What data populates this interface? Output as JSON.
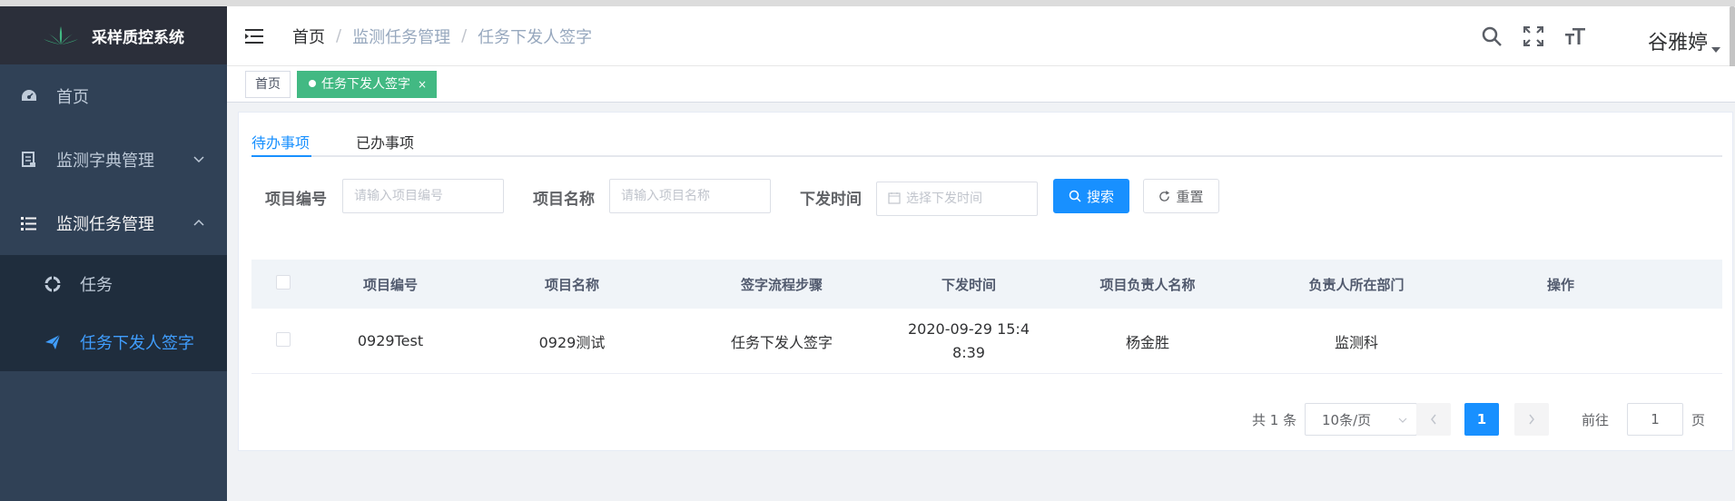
{
  "app": {
    "title": "采样质控系统"
  },
  "sidebar": {
    "items": [
      {
        "label": "首页"
      },
      {
        "label": "监测字典管理"
      },
      {
        "label": "监测任务管理"
      }
    ],
    "subitems": [
      {
        "label": "任务"
      },
      {
        "label": "任务下发人签字"
      }
    ]
  },
  "header": {
    "breadcrumb": [
      "首页",
      "监测任务管理",
      "任务下发人签字"
    ],
    "breadcrumb_sep": "/",
    "username": "谷雅婷"
  },
  "tags": [
    {
      "label": "首页"
    },
    {
      "label": "任务下发人签字",
      "close": "×"
    }
  ],
  "tabs": [
    {
      "label": "待办事项"
    },
    {
      "label": "已办事项"
    }
  ],
  "filters": {
    "project_no": {
      "label": "项目编号",
      "placeholder": "请输入项目编号"
    },
    "project_name": {
      "label": "项目名称",
      "placeholder": "请输入项目名称"
    },
    "issue_time": {
      "label": "下发时间",
      "placeholder": "选择下发时间"
    },
    "search_label": "搜索",
    "reset_label": "重置"
  },
  "table": {
    "columns": [
      "项目编号",
      "项目名称",
      "签字流程步骤",
      "下发时间",
      "项目负责人名称",
      "负责人所在部门",
      "操作"
    ],
    "rows": [
      {
        "project_no": "0929Test",
        "project_name": "0929测试",
        "step": "任务下发人签字",
        "time_line1": "2020-09-29 15:4",
        "time_line2": "8:39",
        "owner": "杨金胜",
        "dept": "监测科",
        "action": ""
      }
    ]
  },
  "pagination": {
    "total_text": "共 1 条",
    "page_size": "10条/页",
    "current_page": "1",
    "goto_prefix": "前往",
    "goto_value": "1",
    "goto_suffix": "页"
  },
  "colors": {
    "sidebar_bg": "#304156",
    "accent": "#1890ff",
    "tag_active": "#42b983"
  }
}
